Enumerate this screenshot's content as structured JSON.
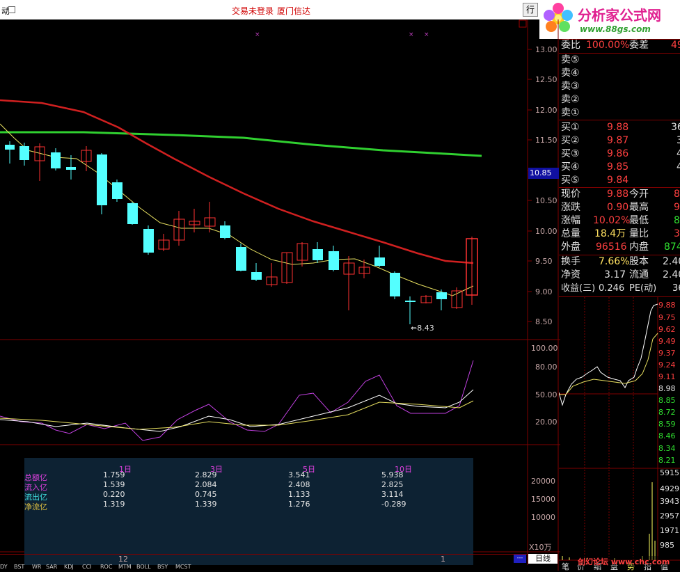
{
  "window": {
    "left_fragment": "动",
    "title_status": "交易未登录",
    "title_broker": "厦门信达",
    "right_button": "行"
  },
  "logo": {
    "main": "分析家公式网",
    "url": "www.88gs.com"
  },
  "price_axis": [
    "13.00",
    "12.50",
    "12.00",
    "11.50",
    "11.00",
    "10.50",
    "10.00",
    "9.50",
    "9.00",
    "8.50"
  ],
  "current_price_label": "10.85",
  "low_marker": "8.43",
  "indicator_axis": [
    "100.00",
    "80.00",
    "50.00",
    "20.00"
  ],
  "volume_axis": [
    "20000",
    "15000",
    "10000"
  ],
  "volume_unit": "X10万",
  "timeline": {
    "label_a": "12",
    "label_b": "1",
    "period_button": "日线",
    "dots": "---"
  },
  "bottom_tabs": [
    "DY",
    "BST",
    "WR",
    "SAR",
    "KDJ",
    "CCI",
    "ROC",
    "MTM",
    "BOLL",
    "BSY",
    "MCST"
  ],
  "fund_flow": {
    "headers": [
      "1日",
      "3日",
      "5日",
      "10日"
    ],
    "rows": [
      {
        "label": "总额亿",
        "color": "#e040e0",
        "values": [
          "1.759",
          "2.829",
          "3.541",
          "5.938"
        ]
      },
      {
        "label": "流入亿",
        "color": "#e040e0",
        "values": [
          "1.539",
          "2.084",
          "2.408",
          "2.825"
        ]
      },
      {
        "label": "流出亿",
        "color": "#40e0e0",
        "values": [
          "0.220",
          "0.745",
          "1.133",
          "3.114"
        ]
      },
      {
        "label": "净流亿",
        "color": "#e0c040",
        "values": [
          "1.319",
          "1.339",
          "1.276",
          "-0.289"
        ]
      }
    ]
  },
  "quote": {
    "weibi_label": "委比",
    "weibi": "100.00%",
    "weicha_label": "委差",
    "weicha": "49",
    "sell": [
      {
        "label": "卖⑤"
      },
      {
        "label": "卖④"
      },
      {
        "label": "卖③"
      },
      {
        "label": "卖②"
      },
      {
        "label": "卖①"
      }
    ],
    "buy": [
      {
        "label": "买①",
        "price": "9.88",
        "vol": "36"
      },
      {
        "label": "买②",
        "price": "9.87",
        "vol": "3"
      },
      {
        "label": "买③",
        "price": "9.86",
        "vol": "4"
      },
      {
        "label": "买④",
        "price": "9.85",
        "vol": "4"
      },
      {
        "label": "买⑤",
        "price": "9.84",
        "vol": ""
      }
    ],
    "stats": [
      {
        "l1": "现价",
        "v1": "9.88",
        "l2": "今开",
        "v2": "8."
      },
      {
        "l1": "涨跌",
        "v1": "0.90",
        "l2": "最高",
        "v2": "9."
      },
      {
        "l1": "涨幅",
        "v1": "10.02%",
        "l2": "最低",
        "v2": "8."
      },
      {
        "l1": "总量",
        "v1": "18.4万",
        "l2": "量比",
        "v2": "3."
      },
      {
        "l1": "外盘",
        "v1": "96516",
        "l2": "内盘",
        "v2": "874"
      },
      {
        "l1": "换手",
        "v1": "7.66%",
        "l2": "股本",
        "v2": "2.40"
      },
      {
        "l1": "净资",
        "v1": "3.17",
        "l2": "流通",
        "v2": "2.40"
      },
      {
        "l1": "收益(三)",
        "v1": "0.246",
        "l2": "PE(动)",
        "v2": "36"
      }
    ]
  },
  "intraday_axis": [
    "9.88",
    "9.75",
    "9.62",
    "9.49",
    "9.37",
    "9.24",
    "9.11",
    "8.98",
    "8.85",
    "8.72",
    "8.59",
    "8.46",
    "8.34",
    "8.21"
  ],
  "intraday_vol_axis": [
    "5915",
    "4929",
    "3943",
    "2957",
    "1971",
    "985"
  ],
  "bottom_right_tabs": [
    "笔",
    "价",
    "细",
    "盘",
    "势",
    "指",
    "值"
  ],
  "watermark": "创幻论坛 www.chc.com",
  "colors": {
    "up": "#ff3232",
    "down": "#54ffff",
    "ma_red": "#d02020",
    "ma_green": "#30d030",
    "ma_yellow": "#e8e060",
    "grid": "#800000"
  }
}
